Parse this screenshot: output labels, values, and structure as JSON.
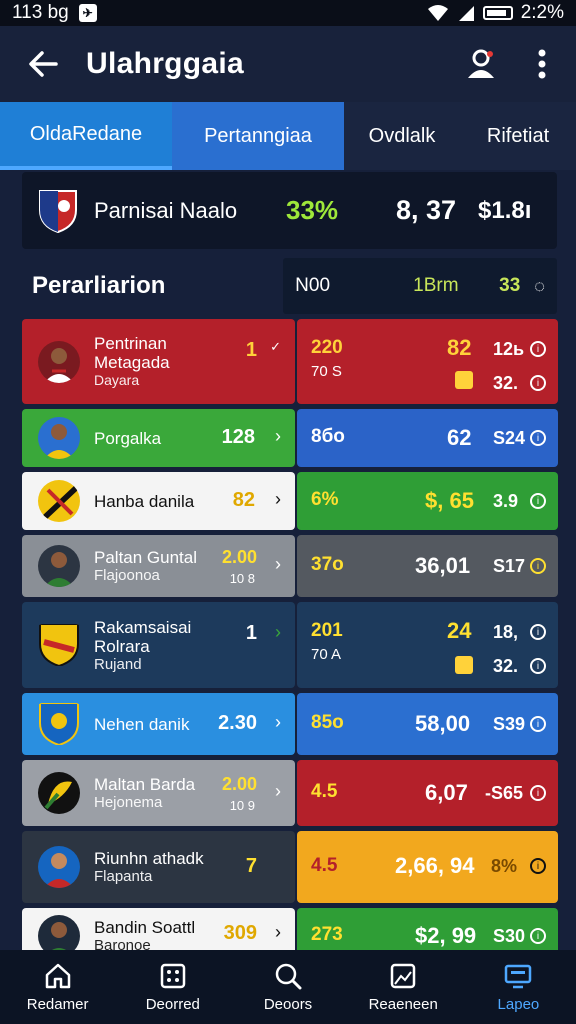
{
  "status_bar": {
    "time": "113 bg",
    "battery_pct": "2:2%"
  },
  "app_bar": {
    "title": "Ulahrggaia"
  },
  "tabs": [
    {
      "label": "OldaRedane"
    },
    {
      "label": "Pertanngiaa"
    },
    {
      "label": "Ovdlalk"
    },
    {
      "label": "Rifetiat"
    }
  ],
  "summary": {
    "name": "Parnisai Naalo",
    "percent": "33%",
    "value": "8, 37",
    "total": "$1.8ı"
  },
  "section": {
    "title": "Perarliarion",
    "col1": "N00",
    "col2": "1Brm",
    "col3": "33"
  },
  "rows": [
    {
      "name1": "Pentrinan",
      "name2": "Metagada",
      "name3": "Dayara",
      "left_num": "1",
      "r_top": "220",
      "r_sub": "70 S",
      "r_mid": "82",
      "r_right": "12ь",
      "r_right2": "32.",
      "colors": {
        "left": "#b4202a",
        "right": "#b4202a",
        "num": "#ffd23a",
        "mid": "#ffd23a",
        "top": "#ffd23a"
      }
    },
    {
      "name1": "Porgalka",
      "left_num": "128",
      "r_top": "8бо",
      "r_mid": "62",
      "r_right": "S24",
      "colors": {
        "left": "#3aa83a",
        "right": "#2b63c8",
        "num": "#ffffff",
        "mid": "#ffffff",
        "top": "#ffffff"
      }
    },
    {
      "name1": "Hanba danila",
      "left_num": "82",
      "r_top": "6%",
      "r_mid": "$, 65",
      "r_right": "3.9",
      "colors": {
        "left": "#f4f4f4",
        "right": "#2f9e36",
        "num": "#e0a800",
        "mid": "#ffe030",
        "top": "#ffe030"
      }
    },
    {
      "name1": "Paltan Guntal",
      "name2": "Flajoonoa",
      "left_num": "2.00",
      "left_sub": "10 8",
      "r_top": "37о",
      "r_mid": "36,01",
      "r_right": "S17",
      "colors": {
        "left": "#8a8f96",
        "right": "#545960",
        "num": "#ffe030",
        "mid": "#ffffff",
        "top": "#ffe030"
      }
    },
    {
      "name1": "Rakamsaisai",
      "name2": "Rolrara",
      "name3": "Rujand",
      "left_num": "1",
      "r_top": "201",
      "r_sub": "70 A",
      "r_mid": "24",
      "r_right": "18,",
      "r_right2": "32.",
      "colors": {
        "left": "#1d3a5c",
        "right": "#1d3a5c",
        "num": "#ffffff",
        "mid": "#ffe030",
        "top": "#ffe030"
      }
    },
    {
      "name1": "Nehen danik",
      "left_num": "2.30",
      "r_top": "85о",
      "r_mid": "58,00",
      "r_right": "S39",
      "colors": {
        "left": "#2a8fe0",
        "right": "#2b6fd0",
        "num": "#ffffff",
        "mid": "#ffffff",
        "top": "#ffe030"
      }
    },
    {
      "name1": "Maltan Barda",
      "name2": "Hejonema",
      "left_num": "2.00",
      "left_sub": "10 9",
      "r_top": "4.5",
      "r_mid": "6,07",
      "r_right": "-S65",
      "colors": {
        "left": "#9b9fa6",
        "right": "#b4202a",
        "num": "#ffe030",
        "mid": "#ffffff",
        "top": "#ffe030"
      }
    },
    {
      "name1": "Riunhn athadk",
      "name2": "Flapanta",
      "left_num": "7",
      "r_top": "4.5",
      "r_mid": "2,66, 94",
      "r_right": "8%",
      "colors": {
        "left": "#2c3542",
        "right": "#f2a81e",
        "num": "#ffe030",
        "mid": "#ffffff",
        "top": "#b4202a"
      }
    },
    {
      "name1": "Bandin Soattl",
      "name2": "Baronoe",
      "left_num": "309",
      "r_top": "273",
      "r_mid": "$2, 99",
      "r_right": "S30",
      "colors": {
        "left": "#f4f4f4",
        "right": "#2f9e36",
        "num": "#e0a800",
        "mid": "#ffffff",
        "top": "#ffe030"
      }
    }
  ],
  "nav": [
    {
      "label": "Redamer",
      "icon": "home-icon"
    },
    {
      "label": "Deorred",
      "icon": "grid-icon"
    },
    {
      "label": "Deoors",
      "icon": "search-icon"
    },
    {
      "label": "Reaeneen",
      "icon": "image-icon"
    },
    {
      "label": "Lapeo",
      "icon": "tv-icon"
    }
  ]
}
